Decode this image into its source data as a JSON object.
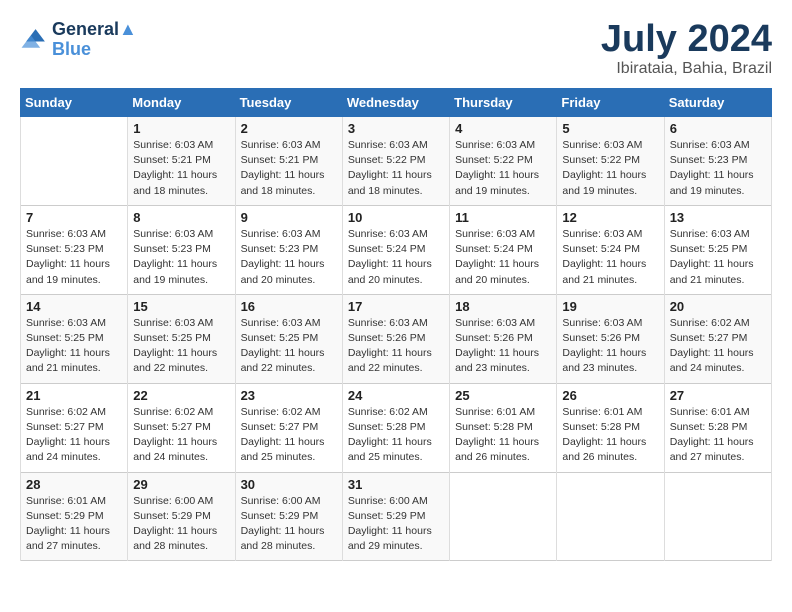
{
  "logo": {
    "line1": "General",
    "line2": "Blue"
  },
  "title": "July 2024",
  "location": "Ibirataia, Bahia, Brazil",
  "headers": [
    "Sunday",
    "Monday",
    "Tuesday",
    "Wednesday",
    "Thursday",
    "Friday",
    "Saturday"
  ],
  "weeks": [
    [
      {
        "day": "",
        "info": ""
      },
      {
        "day": "1",
        "info": "Sunrise: 6:03 AM\nSunset: 5:21 PM\nDaylight: 11 hours\nand 18 minutes."
      },
      {
        "day": "2",
        "info": "Sunrise: 6:03 AM\nSunset: 5:21 PM\nDaylight: 11 hours\nand 18 minutes."
      },
      {
        "day": "3",
        "info": "Sunrise: 6:03 AM\nSunset: 5:22 PM\nDaylight: 11 hours\nand 18 minutes."
      },
      {
        "day": "4",
        "info": "Sunrise: 6:03 AM\nSunset: 5:22 PM\nDaylight: 11 hours\nand 19 minutes."
      },
      {
        "day": "5",
        "info": "Sunrise: 6:03 AM\nSunset: 5:22 PM\nDaylight: 11 hours\nand 19 minutes."
      },
      {
        "day": "6",
        "info": "Sunrise: 6:03 AM\nSunset: 5:23 PM\nDaylight: 11 hours\nand 19 minutes."
      }
    ],
    [
      {
        "day": "7",
        "info": "Sunrise: 6:03 AM\nSunset: 5:23 PM\nDaylight: 11 hours\nand 19 minutes."
      },
      {
        "day": "8",
        "info": "Sunrise: 6:03 AM\nSunset: 5:23 PM\nDaylight: 11 hours\nand 19 minutes."
      },
      {
        "day": "9",
        "info": "Sunrise: 6:03 AM\nSunset: 5:23 PM\nDaylight: 11 hours\nand 20 minutes."
      },
      {
        "day": "10",
        "info": "Sunrise: 6:03 AM\nSunset: 5:24 PM\nDaylight: 11 hours\nand 20 minutes."
      },
      {
        "day": "11",
        "info": "Sunrise: 6:03 AM\nSunset: 5:24 PM\nDaylight: 11 hours\nand 20 minutes."
      },
      {
        "day": "12",
        "info": "Sunrise: 6:03 AM\nSunset: 5:24 PM\nDaylight: 11 hours\nand 21 minutes."
      },
      {
        "day": "13",
        "info": "Sunrise: 6:03 AM\nSunset: 5:25 PM\nDaylight: 11 hours\nand 21 minutes."
      }
    ],
    [
      {
        "day": "14",
        "info": "Sunrise: 6:03 AM\nSunset: 5:25 PM\nDaylight: 11 hours\nand 21 minutes."
      },
      {
        "day": "15",
        "info": "Sunrise: 6:03 AM\nSunset: 5:25 PM\nDaylight: 11 hours\nand 22 minutes."
      },
      {
        "day": "16",
        "info": "Sunrise: 6:03 AM\nSunset: 5:25 PM\nDaylight: 11 hours\nand 22 minutes."
      },
      {
        "day": "17",
        "info": "Sunrise: 6:03 AM\nSunset: 5:26 PM\nDaylight: 11 hours\nand 22 minutes."
      },
      {
        "day": "18",
        "info": "Sunrise: 6:03 AM\nSunset: 5:26 PM\nDaylight: 11 hours\nand 23 minutes."
      },
      {
        "day": "19",
        "info": "Sunrise: 6:03 AM\nSunset: 5:26 PM\nDaylight: 11 hours\nand 23 minutes."
      },
      {
        "day": "20",
        "info": "Sunrise: 6:02 AM\nSunset: 5:27 PM\nDaylight: 11 hours\nand 24 minutes."
      }
    ],
    [
      {
        "day": "21",
        "info": "Sunrise: 6:02 AM\nSunset: 5:27 PM\nDaylight: 11 hours\nand 24 minutes."
      },
      {
        "day": "22",
        "info": "Sunrise: 6:02 AM\nSunset: 5:27 PM\nDaylight: 11 hours\nand 24 minutes."
      },
      {
        "day": "23",
        "info": "Sunrise: 6:02 AM\nSunset: 5:27 PM\nDaylight: 11 hours\nand 25 minutes."
      },
      {
        "day": "24",
        "info": "Sunrise: 6:02 AM\nSunset: 5:28 PM\nDaylight: 11 hours\nand 25 minutes."
      },
      {
        "day": "25",
        "info": "Sunrise: 6:01 AM\nSunset: 5:28 PM\nDaylight: 11 hours\nand 26 minutes."
      },
      {
        "day": "26",
        "info": "Sunrise: 6:01 AM\nSunset: 5:28 PM\nDaylight: 11 hours\nand 26 minutes."
      },
      {
        "day": "27",
        "info": "Sunrise: 6:01 AM\nSunset: 5:28 PM\nDaylight: 11 hours\nand 27 minutes."
      }
    ],
    [
      {
        "day": "28",
        "info": "Sunrise: 6:01 AM\nSunset: 5:29 PM\nDaylight: 11 hours\nand 27 minutes."
      },
      {
        "day": "29",
        "info": "Sunrise: 6:00 AM\nSunset: 5:29 PM\nDaylight: 11 hours\nand 28 minutes."
      },
      {
        "day": "30",
        "info": "Sunrise: 6:00 AM\nSunset: 5:29 PM\nDaylight: 11 hours\nand 28 minutes."
      },
      {
        "day": "31",
        "info": "Sunrise: 6:00 AM\nSunset: 5:29 PM\nDaylight: 11 hours\nand 29 minutes."
      },
      {
        "day": "",
        "info": ""
      },
      {
        "day": "",
        "info": ""
      },
      {
        "day": "",
        "info": ""
      }
    ]
  ]
}
